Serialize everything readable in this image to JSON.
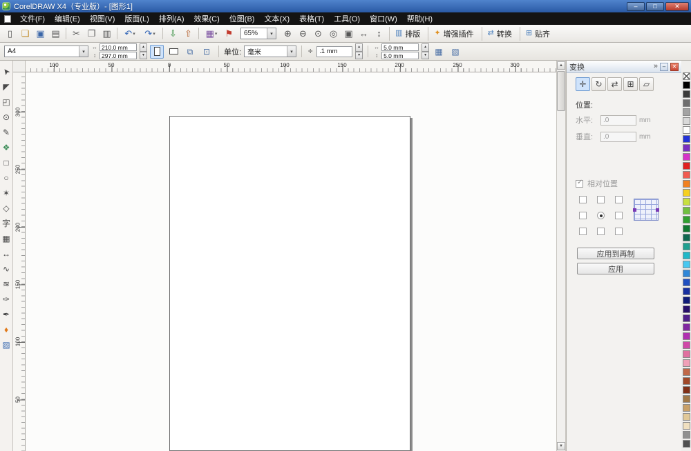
{
  "theme": {
    "titlebar-a": "#4f83cc",
    "titlebar-b": "#2a5aa5",
    "menubar": "#141414",
    "close-red": "#c74634",
    "accent": "#cfe3fb"
  },
  "window": {
    "title": "CorelDRAW X4（专业版）- [图形1]",
    "minimize_glyph": "–",
    "maximize_glyph": "□",
    "close_glyph": "✕"
  },
  "menus": [
    {
      "t": "文件(F)",
      "n": "menu-file"
    },
    {
      "t": "编辑(E)",
      "n": "menu-edit"
    },
    {
      "t": "视图(V)",
      "n": "menu-view"
    },
    {
      "t": "版面(L)",
      "n": "menu-layout"
    },
    {
      "t": "排列(A)",
      "n": "menu-arrange"
    },
    {
      "t": "效果(C)",
      "n": "menu-effects"
    },
    {
      "t": "位图(B)",
      "n": "menu-bitmaps"
    },
    {
      "t": "文本(X)",
      "n": "menu-text"
    },
    {
      "t": "表格(T)",
      "n": "menu-table"
    },
    {
      "t": "工具(O)",
      "n": "menu-tools"
    },
    {
      "t": "窗口(W)",
      "n": "menu-window"
    },
    {
      "t": "帮助(H)",
      "n": "menu-help"
    }
  ],
  "toolbar": {
    "zoom_value": "65%",
    "items": [
      {
        "g": "▯",
        "n": "new-document-icon",
        "c": "#5a5a5a"
      },
      {
        "g": "❏",
        "n": "open-icon",
        "c": "#c08c2a"
      },
      {
        "g": "▣",
        "n": "save-icon",
        "c": "#3a66a8"
      },
      {
        "g": "▤",
        "n": "print-icon",
        "c": "#5a5a5a"
      },
      {
        "n": "separator",
        "cls": "sep"
      },
      {
        "g": "✂",
        "n": "cut-icon",
        "c": "#5a5a5a"
      },
      {
        "g": "❐",
        "n": "copy-icon",
        "c": "#5a5a5a"
      },
      {
        "g": "▥",
        "n": "paste-icon",
        "c": "#5a5a5a"
      },
      {
        "n": "separator",
        "cls": "sep"
      },
      {
        "g": "↶",
        "n": "undo-icon",
        "c": "#2f62b5",
        "cls": "drop"
      },
      {
        "g": "↷",
        "n": "redo-icon",
        "c": "#2f62b5",
        "cls": "drop"
      },
      {
        "n": "separator",
        "cls": "sep"
      },
      {
        "g": "⇩",
        "n": "import-icon",
        "c": "#2f8a3a"
      },
      {
        "g": "⇧",
        "n": "export-icon",
        "c": "#b05620"
      },
      {
        "n": "separator",
        "cls": "sep"
      },
      {
        "g": "▦",
        "n": "application-launcher-icon",
        "c": "#7a4fa0",
        "cls": "drop"
      },
      {
        "g": "⚑",
        "n": "welcome-screen-icon",
        "c": "#c23b2e"
      }
    ],
    "zoom_items": [
      {
        "g": "⊕",
        "n": "zoom-in-icon",
        "c": "#555555"
      },
      {
        "g": "⊖",
        "n": "zoom-out-icon",
        "c": "#555555"
      },
      {
        "g": "⊙",
        "n": "zoom-selected-icon",
        "c": "#555555"
      },
      {
        "g": "◎",
        "n": "zoom-all-objects-icon",
        "c": "#555555"
      },
      {
        "g": "▣",
        "n": "zoom-page-icon",
        "c": "#555555"
      },
      {
        "g": "↔",
        "n": "zoom-page-width-icon",
        "c": "#555555"
      },
      {
        "g": "↕",
        "n": "zoom-page-height-icon",
        "c": "#555555"
      }
    ],
    "text_buttons": [
      {
        "g": "▥",
        "t": "排版",
        "n": "typesetting-button",
        "c": "#4a7ebb"
      },
      {
        "g": "✦",
        "t": "增强插件",
        "n": "enhanced-plugins-button",
        "c": "#e09020"
      },
      {
        "g": "⇄",
        "t": "转换",
        "n": "convert-button",
        "c": "#4a7ebb"
      },
      {
        "g": "⊞",
        "t": "贴齐",
        "n": "snap-button",
        "c": "#4a7ebb"
      }
    ]
  },
  "propbar": {
    "paper_size": "A4",
    "paper_width": "210.0 mm",
    "paper_height": "297.0 mm",
    "units_label": "单位:",
    "units_value": "毫米",
    "nudge_value": ".1 mm",
    "dup_x": "5.0 mm",
    "dup_y": "5.0 mm"
  },
  "toolbox": {
    "tools": [
      {
        "g": "➤",
        "n": "pick-tool",
        "cls": "rot-nw"
      },
      {
        "g": "◤",
        "n": "shape-tool"
      },
      {
        "g": "◰",
        "n": "crop-tool"
      },
      {
        "g": "⊙",
        "n": "zoom-tool"
      },
      {
        "g": "✎",
        "n": "freehand-tool"
      },
      {
        "g": "❖",
        "n": "smart-fill-tool",
        "c": "#3f8e5a"
      },
      {
        "g": "□",
        "n": "rectangle-tool"
      },
      {
        "g": "○",
        "n": "ellipse-tool"
      },
      {
        "g": "✶",
        "n": "polygon-tool"
      },
      {
        "g": "◇",
        "n": "basic-shapes-tool"
      },
      {
        "g": "字",
        "n": "text-tool"
      },
      {
        "g": "▦",
        "n": "table-tool"
      },
      {
        "g": "↔",
        "n": "dimension-tool"
      },
      {
        "g": "∿",
        "n": "connector-tool"
      },
      {
        "g": "≋",
        "n": "blend-tool"
      },
      {
        "g": "✑",
        "n": "eyedropper-tool"
      },
      {
        "g": "✒",
        "n": "outline-pen-tool",
        "c": "#444444"
      },
      {
        "g": "♦",
        "n": "fill-tool",
        "c": "#e07818"
      },
      {
        "g": "▨",
        "n": "interactive-fill-tool",
        "c": "#3a6ab0"
      }
    ]
  },
  "hruler": {
    "labels": [
      "100",
      "50",
      "0",
      "50",
      "100",
      "150",
      "200",
      "250",
      "300"
    ]
  },
  "vruler": {
    "labels": [
      "300",
      "250",
      "200",
      "150",
      "100",
      "50"
    ]
  },
  "docker": {
    "title": "变换",
    "chevron": "»",
    "collapse_glyph": "–",
    "close_glyph": "✕",
    "tools": [
      {
        "g": "✛",
        "n": "position-transform-button",
        "cls": "active"
      },
      {
        "g": "↻",
        "n": "rotate-transform-button"
      },
      {
        "g": "⇄",
        "n": "scale-mirror-transform-button"
      },
      {
        "g": "⊞",
        "n": "size-transform-button"
      },
      {
        "g": "▱",
        "n": "skew-transform-button"
      }
    ],
    "position_label": "位置:",
    "h_label": "水平:",
    "h_value": ".0",
    "h_unit": "mm",
    "v_label": "垂直:",
    "v_value": ".0",
    "v_unit": "mm",
    "relative_label": "相对位置",
    "grid": [
      {
        "n": "anchor-top-left",
        "cls": "chk"
      },
      {
        "n": "anchor-top",
        "cls": "chk"
      },
      {
        "n": "anchor-top-right",
        "cls": "chk"
      },
      {
        "n": "anchor-left",
        "cls": "chk"
      },
      {
        "n": "anchor-center",
        "cls": "rad"
      },
      {
        "n": "anchor-right",
        "cls": "chk"
      },
      {
        "n": "anchor-bottom-left",
        "cls": "chk"
      },
      {
        "n": "anchor-bottom",
        "cls": "chk"
      },
      {
        "n": "anchor-bottom-right",
        "cls": "chk"
      }
    ],
    "apply_duplicate_label": "应用到再制",
    "apply_label": "应用"
  },
  "palette": {
    "colors": [
      "#000000",
      "#3b3b3b",
      "#6e6e6e",
      "#a3a3a3",
      "#d9d9d9",
      "#ffffff",
      "#2433d8",
      "#7a2fc0",
      "#d633c8",
      "#e02020",
      "#f05a50",
      "#f08020",
      "#f6d020",
      "#c8e040",
      "#70c040",
      "#30a030",
      "#107830",
      "#106850",
      "#20a090",
      "#20b8c8",
      "#48c8f0",
      "#3088d8",
      "#2050c0",
      "#1830a0",
      "#101c78",
      "#28106a",
      "#50208a",
      "#8028a0",
      "#b030b0",
      "#d048a8",
      "#e070a0",
      "#f0a0b8",
      "#c06848",
      "#a04828",
      "#803018",
      "#a07848",
      "#c8a068",
      "#e0c898",
      "#f0e0c0",
      "#909090",
      "#505050"
    ]
  }
}
